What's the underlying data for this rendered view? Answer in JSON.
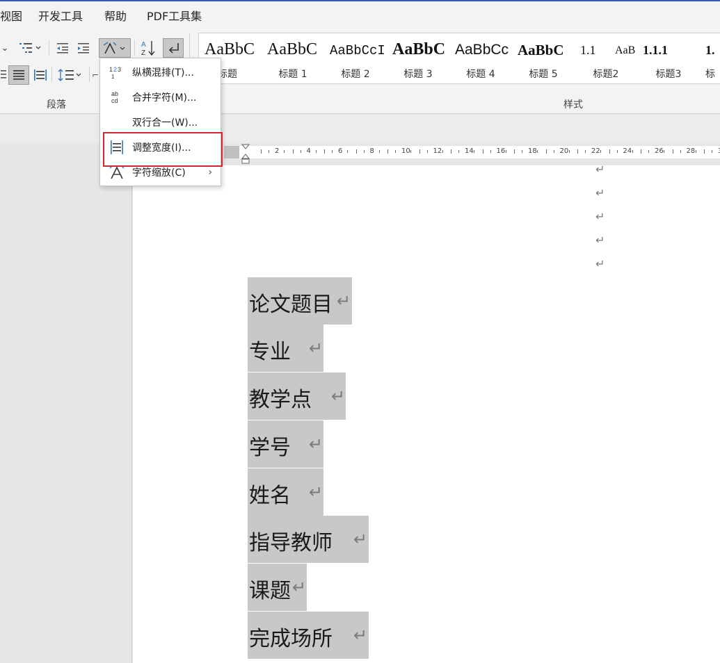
{
  "tabs": [
    "视图",
    "开发工具",
    "帮助",
    "PDF工具集"
  ],
  "ribbon": {
    "paragraph_group_label": "段落",
    "styles_group_label": "样式",
    "styles": [
      {
        "sample": "AaBbC",
        "name": "标题"
      },
      {
        "sample": "AaBbC",
        "name": "标题 1"
      },
      {
        "sample": "AaBbCcI",
        "name": "标题 2"
      },
      {
        "sample": "AaBbC",
        "name": "标题 3"
      },
      {
        "sample": "AaBbCc",
        "name": "标题 4"
      },
      {
        "sample": "AaBbC",
        "name": "标题 5"
      },
      {
        "sample": "1.1",
        "name": "标题2"
      },
      {
        "sample": "AaB",
        "name": ""
      },
      {
        "sample": "1.1.1",
        "name": "标题3"
      },
      {
        "sample": "1.",
        "name": "标"
      }
    ]
  },
  "menu": {
    "items": [
      {
        "icon": "vertical-horizontal-icon",
        "label": "纵横混排(T)..."
      },
      {
        "icon": "combine-characters-icon",
        "label": "合并字符(M)..."
      },
      {
        "icon": "",
        "label": "双行合一(W)..."
      },
      {
        "icon": "fit-text-icon",
        "label": "调整宽度(I)..."
      },
      {
        "icon": "character-scale-icon",
        "label": "字符缩放(C)"
      }
    ],
    "highlighted_item": "调整宽度(I)..."
  },
  "ruler": {
    "labels": [
      "2",
      "4",
      "6",
      "8",
      "10",
      "12",
      "14",
      "16",
      "18",
      "20",
      "22",
      "24",
      "26",
      "28",
      "3"
    ]
  },
  "document": {
    "paragraph_mark": "↵",
    "lines": [
      "论文题目",
      "专业",
      "教学点",
      "学号",
      "姓名",
      "指导教师",
      "课题",
      "完成场所"
    ]
  },
  "colors": {
    "highlight_box": "#d9252d",
    "selection": "#c8c8c8",
    "accent_bar": "#3b5aa6"
  }
}
